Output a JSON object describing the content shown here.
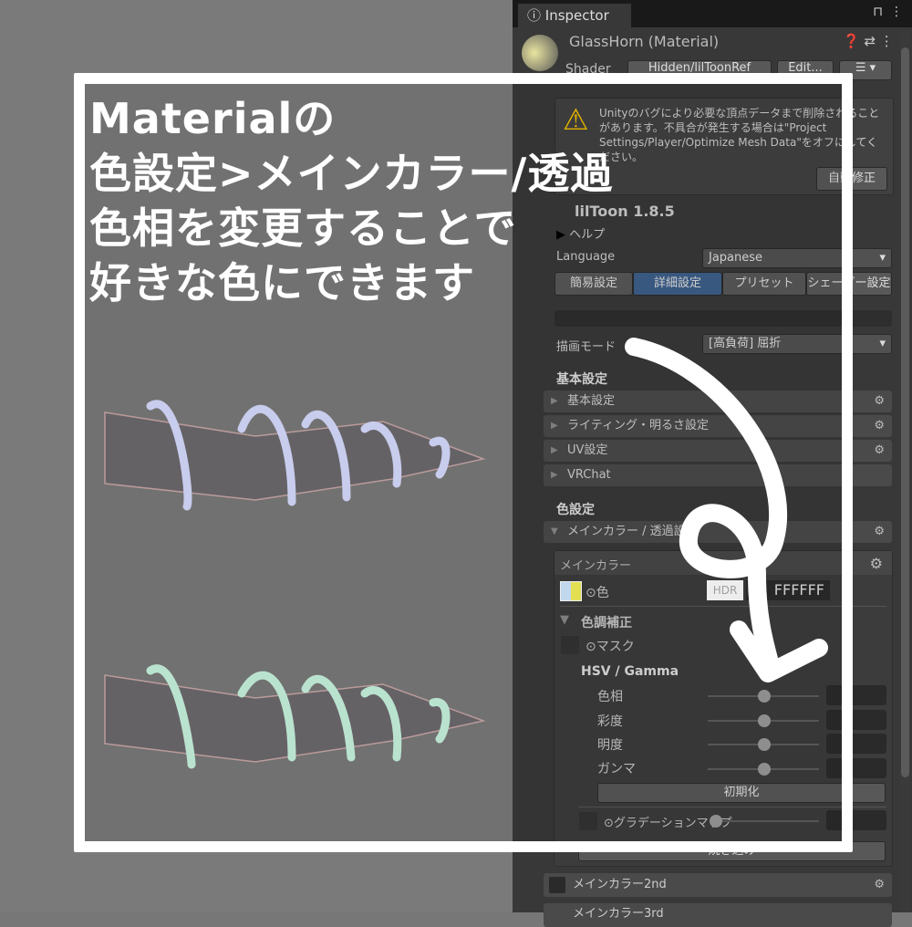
{
  "inspector": {
    "tab": "Inspector",
    "title": "GlassHorn (Material)",
    "shader_label": "Shader",
    "shader_value": "Hidden/lilToonRef",
    "edit": "Edit...",
    "warning": "Unityのバグにより必要な頂点データまで削除されることがあります。不具合が発生する場合は\"Project Settings/Player/Optimize Mesh Data\"をオフにしてください。",
    "autofix": "自動修正",
    "version": "lilToon 1.8.5",
    "help": "ヘルプ",
    "language_label": "Language",
    "language_value": "Japanese",
    "mode_tabs": [
      "簡易設定",
      "詳細設定",
      "プリセット",
      "シェーダー設定"
    ],
    "render_mode_label": "描画モード",
    "render_mode_value": "[高負荷] 屈折",
    "basic_header": "基本設定",
    "basic_items": [
      "基本設定",
      "ライティング・明るさ設定",
      "UV設定",
      "VRChat"
    ],
    "color_header": "色設定",
    "main_fold": "メインカラー / 透過設定",
    "main_color": {
      "title": "メインカラー",
      "color_label": "⊙色",
      "hdr": "HDR",
      "hex": "FFFFFF",
      "correction": "色調補正",
      "mask": "⊙マスク",
      "hsv_title": "HSV / Gamma",
      "sliders": [
        {
          "label": "色相",
          "value": 0.5
        },
        {
          "label": "彩度",
          "value": 0.5
        },
        {
          "label": "明度",
          "value": 0.5
        },
        {
          "label": "ガンマ",
          "value": 0.5
        }
      ],
      "reset": "初期化",
      "gradient": "⊙グラデーションマップ",
      "bake": "焼き込み"
    },
    "main2": "メインカラー2nd",
    "main3": "メインカラー3rd"
  },
  "overlay": {
    "lines": [
      "Materialの",
      "色設定>メインカラー/透過",
      "色相を変更することで",
      "好きな色にできます"
    ]
  },
  "colors": {
    "accent": "#3e5f8a",
    "warning": "#f0c000"
  }
}
